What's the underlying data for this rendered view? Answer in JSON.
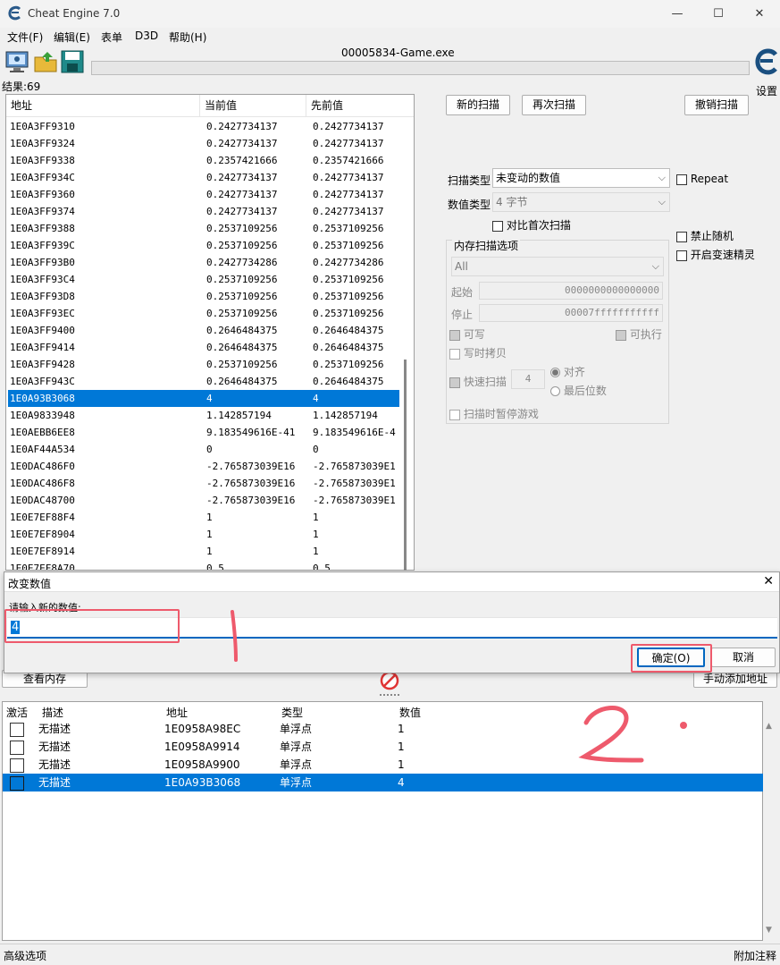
{
  "window": {
    "title": "Cheat Engine 7.0",
    "minimize": "—",
    "maximize": "☐",
    "close": "✕"
  },
  "menu": [
    "文件(F)",
    "编辑(E)",
    "表单",
    "D3D",
    "帮助(H)"
  ],
  "process_name": "00005834-Game.exe",
  "results_label": "结果:69",
  "settings_label": "设置",
  "scan_list": {
    "headers": [
      "地址",
      "当前值",
      "先前值"
    ],
    "rows": [
      [
        "1E0A3FF9310",
        "0.2427734137",
        "0.2427734137"
      ],
      [
        "1E0A3FF9324",
        "0.2427734137",
        "0.2427734137"
      ],
      [
        "1E0A3FF9338",
        "0.2357421666",
        "0.2357421666"
      ],
      [
        "1E0A3FF934C",
        "0.2427734137",
        "0.2427734137"
      ],
      [
        "1E0A3FF9360",
        "0.2427734137",
        "0.2427734137"
      ],
      [
        "1E0A3FF9374",
        "0.2427734137",
        "0.2427734137"
      ],
      [
        "1E0A3FF9388",
        "0.2537109256",
        "0.2537109256"
      ],
      [
        "1E0A3FF939C",
        "0.2537109256",
        "0.2537109256"
      ],
      [
        "1E0A3FF93B0",
        "0.2427734286",
        "0.2427734286"
      ],
      [
        "1E0A3FF93C4",
        "0.2537109256",
        "0.2537109256"
      ],
      [
        "1E0A3FF93D8",
        "0.2537109256",
        "0.2537109256"
      ],
      [
        "1E0A3FF93EC",
        "0.2537109256",
        "0.2537109256"
      ],
      [
        "1E0A3FF9400",
        "0.2646484375",
        "0.2646484375"
      ],
      [
        "1E0A3FF9414",
        "0.2646484375",
        "0.2646484375"
      ],
      [
        "1E0A3FF9428",
        "0.2537109256",
        "0.2537109256"
      ],
      [
        "1E0A3FF943C",
        "0.2646484375",
        "0.2646484375"
      ],
      [
        "1E0A93B3068",
        "4",
        "4"
      ],
      [
        "1E0A9833948",
        "1.142857194",
        "1.142857194"
      ],
      [
        "1E0AEBB6EE8",
        "9.183549616E-41",
        "9.183549616E-4"
      ],
      [
        "1E0AF44A534",
        "0",
        "0"
      ],
      [
        "1E0DAC486F0",
        "-2.765873039E16",
        "-2.765873039E1"
      ],
      [
        "1E0DAC486F8",
        "-2.765873039E16",
        "-2.765873039E1"
      ],
      [
        "1E0DAC48700",
        "-2.765873039E16",
        "-2.765873039E1"
      ],
      [
        "1E0E7EF88F4",
        "1",
        "1"
      ],
      [
        "1E0E7EF8904",
        "1",
        "1"
      ],
      [
        "1E0E7EF8914",
        "1",
        "1"
      ],
      [
        "1E0E7EF8A70",
        "0.5",
        "0.5"
      ]
    ],
    "selected_index": 16
  },
  "scan_buttons": {
    "new_scan": "新的扫描",
    "next_scan": "再次扫描",
    "undo_scan": "撤销扫描"
  },
  "scan_options": {
    "scan_type_label": "扫描类型",
    "scan_type_value": "未变动的数值",
    "value_type_label": "数值类型",
    "value_type_value": "4 字节",
    "compare_first": "对比首次扫描",
    "repeat": "Repeat",
    "disable_random": "禁止随机",
    "speedhack": "开启变速精灵",
    "memory_options_title": "内存扫描选项",
    "region": "All",
    "start_label": "起始",
    "start_value": "0000000000000000",
    "stop_label": "停止",
    "stop_value": "00007fffffffffff",
    "writable": "可写",
    "executable": "可执行",
    "copy_on_write": "写时拷贝",
    "fast_scan": "快速扫描",
    "fast_scan_value": "4",
    "align": "对齐",
    "last_digits": "最后位数",
    "pause_game": "扫描时暂停游戏"
  },
  "dialog": {
    "title": "改变数值",
    "prompt": "请输入新的数值:",
    "value": "4",
    "ok": "确定(O)",
    "cancel": "取消"
  },
  "mid_buttons": {
    "view_memory": "查看内存",
    "add_address": "手动添加地址"
  },
  "cheat_table": {
    "headers": [
      "激活",
      "描述",
      "地址",
      "类型",
      "数值"
    ],
    "rows": [
      [
        "无描述",
        "1E0958A98EC",
        "单浮点",
        "1"
      ],
      [
        "无描述",
        "1E0958A9914",
        "单浮点",
        "1"
      ],
      [
        "无描述",
        "1E0958A9900",
        "单浮点",
        "1"
      ],
      [
        "无描述",
        "1E0A93B3068",
        "单浮点",
        "4"
      ]
    ],
    "selected_index": 3
  },
  "status": {
    "left": "高级选项",
    "right": "附加注释"
  },
  "annotations": {
    "mark1": "1",
    "mark2": "2."
  },
  "colors": {
    "selection": "#0078d7",
    "annotation": "#ee5a6c",
    "input_underline": "#0067c0"
  }
}
